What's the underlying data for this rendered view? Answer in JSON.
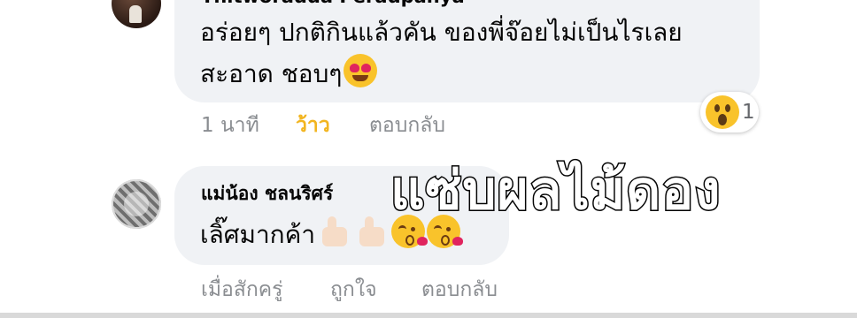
{
  "comments": [
    {
      "author": "Tnitworadda Peradpanya",
      "text_line1": "อร่อยๆ ปกติกินแล้วคัน ของพี่จ๊อยไม่เป็นไรเลย",
      "text_line2": "สะอาด ชอบๆ",
      "emoji": "smiling-face-with-heart-eyes",
      "time": "1 นาที",
      "like_label": "ว้าว",
      "reply_label": "ตอบกลับ",
      "reaction": {
        "icon": "wow-reaction",
        "count": "1"
      }
    },
    {
      "author": "แม่น้อง ชลนริศร์",
      "text": "เลิ๊ศมากค้า",
      "emojis": [
        "thumbs-up",
        "thumbs-up",
        "face-blowing-kiss",
        "face-blowing-kiss"
      ],
      "time": "เมื่อสักครู่",
      "like_label": "ถูกใจ",
      "reply_label": "ตอบกลับ"
    }
  ],
  "watermark_text": "แซ่บผลไม้ดอง",
  "colors": {
    "bubble": "#f0f2f5",
    "meta_text": "#8a8d91",
    "wow_active": "#f2b520"
  }
}
